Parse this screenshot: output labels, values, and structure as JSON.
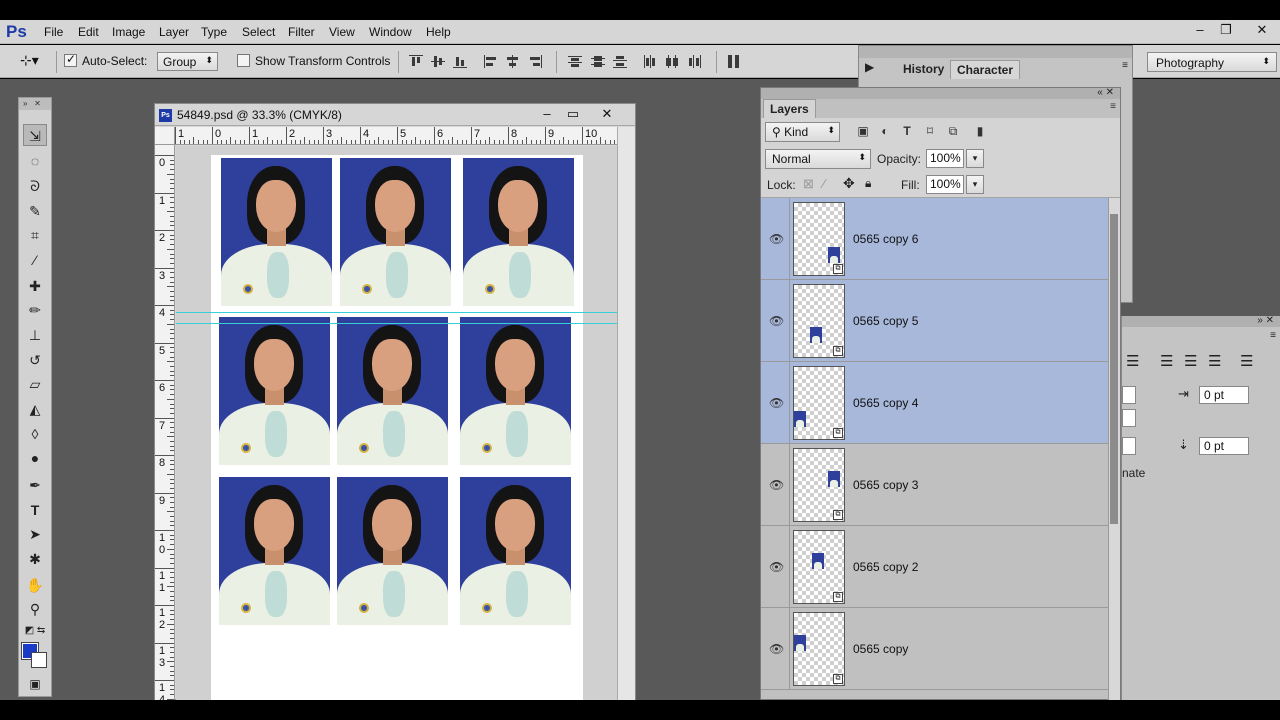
{
  "app": {
    "logo": "Ps",
    "menu": [
      "File",
      "Edit",
      "Image",
      "Layer",
      "Type",
      "Select",
      "Filter",
      "View",
      "Window",
      "Help"
    ],
    "window_controls": [
      "–",
      "❐",
      "✕"
    ]
  },
  "options_bar": {
    "auto_select_label": "Auto-Select:",
    "auto_select_checked": true,
    "auto_select_target": "Group",
    "show_transform_label": "Show Transform Controls",
    "show_transform_checked": false
  },
  "workspace_selector": "Photography",
  "document": {
    "title": "54849.psd @ 33.3% (CMYK/8)",
    "ruler_h": [
      "1",
      "0",
      "1",
      "2",
      "3",
      "4",
      "5",
      "6",
      "7",
      "8",
      "9",
      "10"
    ],
    "ruler_v": [
      "0",
      "1",
      "2",
      "3",
      "4",
      "5",
      "6",
      "7",
      "8",
      "9",
      "1\n0",
      "1\n1",
      "1\n2",
      "1\n3",
      "1\n4"
    ],
    "photo_rows": 3,
    "photo_cols": 3
  },
  "history_panel": {
    "tabs": [
      "History",
      "Character"
    ],
    "active_tab": "Character"
  },
  "character_panel": {
    "indent_right": "0 pt",
    "space_after": "0 pt",
    "partial_text": "nate"
  },
  "layers_panel": {
    "tab": "Layers",
    "kind_filter": "Kind",
    "blend_mode": "Normal",
    "opacity_label": "Opacity:",
    "opacity": "100%",
    "lock_label": "Lock:",
    "fill_label": "Fill:",
    "fill": "100%",
    "layers": [
      {
        "name": "0565 copy 6",
        "selected": true
      },
      {
        "name": "0565 copy 5",
        "selected": true
      },
      {
        "name": "0565 copy 4",
        "selected": true
      },
      {
        "name": "0565 copy 3",
        "selected": false
      },
      {
        "name": "0565 copy 2",
        "selected": false
      },
      {
        "name": "0565 copy",
        "selected": false
      }
    ]
  },
  "colors": {
    "foreground": "#1a3ac8",
    "background": "#ffffff",
    "selection": "#a8b8db",
    "photo_backdrop": "#2e3f9c",
    "guide": "#38d0d8"
  }
}
